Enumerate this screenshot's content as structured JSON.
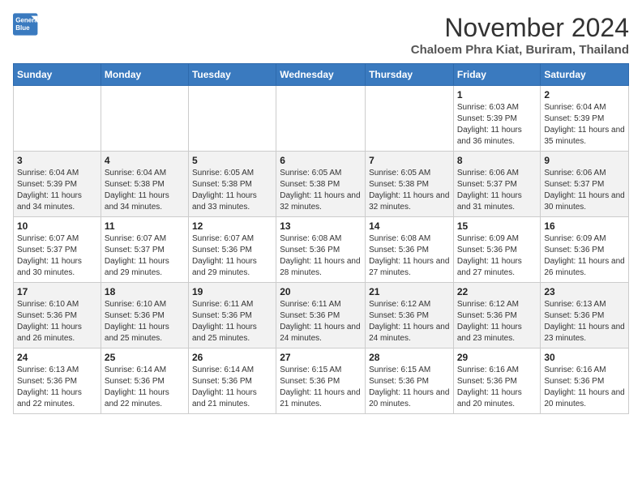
{
  "logo": {
    "line1": "General",
    "line2": "Blue"
  },
  "title": "November 2024",
  "location": "Chaloem Phra Kiat, Buriram, Thailand",
  "days_of_week": [
    "Sunday",
    "Monday",
    "Tuesday",
    "Wednesday",
    "Thursday",
    "Friday",
    "Saturday"
  ],
  "weeks": [
    [
      {
        "day": "",
        "info": ""
      },
      {
        "day": "",
        "info": ""
      },
      {
        "day": "",
        "info": ""
      },
      {
        "day": "",
        "info": ""
      },
      {
        "day": "",
        "info": ""
      },
      {
        "day": "1",
        "info": "Sunrise: 6:03 AM\nSunset: 5:39 PM\nDaylight: 11 hours and 36 minutes."
      },
      {
        "day": "2",
        "info": "Sunrise: 6:04 AM\nSunset: 5:39 PM\nDaylight: 11 hours and 35 minutes."
      }
    ],
    [
      {
        "day": "3",
        "info": "Sunrise: 6:04 AM\nSunset: 5:39 PM\nDaylight: 11 hours and 34 minutes."
      },
      {
        "day": "4",
        "info": "Sunrise: 6:04 AM\nSunset: 5:38 PM\nDaylight: 11 hours and 34 minutes."
      },
      {
        "day": "5",
        "info": "Sunrise: 6:05 AM\nSunset: 5:38 PM\nDaylight: 11 hours and 33 minutes."
      },
      {
        "day": "6",
        "info": "Sunrise: 6:05 AM\nSunset: 5:38 PM\nDaylight: 11 hours and 32 minutes."
      },
      {
        "day": "7",
        "info": "Sunrise: 6:05 AM\nSunset: 5:38 PM\nDaylight: 11 hours and 32 minutes."
      },
      {
        "day": "8",
        "info": "Sunrise: 6:06 AM\nSunset: 5:37 PM\nDaylight: 11 hours and 31 minutes."
      },
      {
        "day": "9",
        "info": "Sunrise: 6:06 AM\nSunset: 5:37 PM\nDaylight: 11 hours and 30 minutes."
      }
    ],
    [
      {
        "day": "10",
        "info": "Sunrise: 6:07 AM\nSunset: 5:37 PM\nDaylight: 11 hours and 30 minutes."
      },
      {
        "day": "11",
        "info": "Sunrise: 6:07 AM\nSunset: 5:37 PM\nDaylight: 11 hours and 29 minutes."
      },
      {
        "day": "12",
        "info": "Sunrise: 6:07 AM\nSunset: 5:36 PM\nDaylight: 11 hours and 29 minutes."
      },
      {
        "day": "13",
        "info": "Sunrise: 6:08 AM\nSunset: 5:36 PM\nDaylight: 11 hours and 28 minutes."
      },
      {
        "day": "14",
        "info": "Sunrise: 6:08 AM\nSunset: 5:36 PM\nDaylight: 11 hours and 27 minutes."
      },
      {
        "day": "15",
        "info": "Sunrise: 6:09 AM\nSunset: 5:36 PM\nDaylight: 11 hours and 27 minutes."
      },
      {
        "day": "16",
        "info": "Sunrise: 6:09 AM\nSunset: 5:36 PM\nDaylight: 11 hours and 26 minutes."
      }
    ],
    [
      {
        "day": "17",
        "info": "Sunrise: 6:10 AM\nSunset: 5:36 PM\nDaylight: 11 hours and 26 minutes."
      },
      {
        "day": "18",
        "info": "Sunrise: 6:10 AM\nSunset: 5:36 PM\nDaylight: 11 hours and 25 minutes."
      },
      {
        "day": "19",
        "info": "Sunrise: 6:11 AM\nSunset: 5:36 PM\nDaylight: 11 hours and 25 minutes."
      },
      {
        "day": "20",
        "info": "Sunrise: 6:11 AM\nSunset: 5:36 PM\nDaylight: 11 hours and 24 minutes."
      },
      {
        "day": "21",
        "info": "Sunrise: 6:12 AM\nSunset: 5:36 PM\nDaylight: 11 hours and 24 minutes."
      },
      {
        "day": "22",
        "info": "Sunrise: 6:12 AM\nSunset: 5:36 PM\nDaylight: 11 hours and 23 minutes."
      },
      {
        "day": "23",
        "info": "Sunrise: 6:13 AM\nSunset: 5:36 PM\nDaylight: 11 hours and 23 minutes."
      }
    ],
    [
      {
        "day": "24",
        "info": "Sunrise: 6:13 AM\nSunset: 5:36 PM\nDaylight: 11 hours and 22 minutes."
      },
      {
        "day": "25",
        "info": "Sunrise: 6:14 AM\nSunset: 5:36 PM\nDaylight: 11 hours and 22 minutes."
      },
      {
        "day": "26",
        "info": "Sunrise: 6:14 AM\nSunset: 5:36 PM\nDaylight: 11 hours and 21 minutes."
      },
      {
        "day": "27",
        "info": "Sunrise: 6:15 AM\nSunset: 5:36 PM\nDaylight: 11 hours and 21 minutes."
      },
      {
        "day": "28",
        "info": "Sunrise: 6:15 AM\nSunset: 5:36 PM\nDaylight: 11 hours and 20 minutes."
      },
      {
        "day": "29",
        "info": "Sunrise: 6:16 AM\nSunset: 5:36 PM\nDaylight: 11 hours and 20 minutes."
      },
      {
        "day": "30",
        "info": "Sunrise: 6:16 AM\nSunset: 5:36 PM\nDaylight: 11 hours and 20 minutes."
      }
    ]
  ]
}
